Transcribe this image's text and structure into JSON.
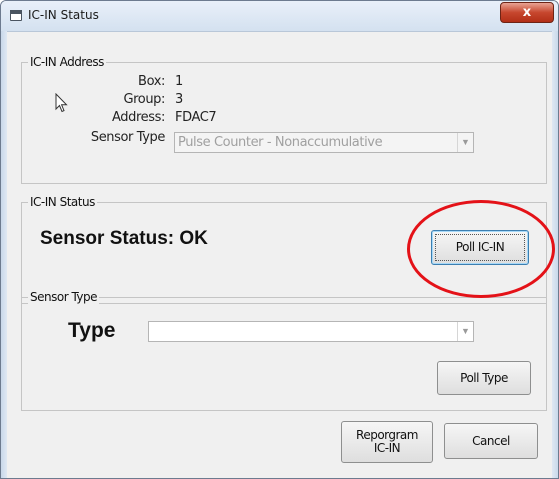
{
  "window": {
    "title": "IC-IN Status",
    "close_glyph": "x"
  },
  "address_group": {
    "legend": "IC-IN Address",
    "box_label": "Box:",
    "box_value": "1",
    "group_label": "Group:",
    "group_value": "3",
    "address_label": "Address:",
    "address_value": "FDAC7",
    "sensor_type_label": "Sensor Type",
    "sensor_type_value": "Pulse Counter - Nonaccumulative"
  },
  "status_group": {
    "legend": "IC-IN Status",
    "status_text": "Sensor Status: OK",
    "poll_button": "Poll IC-IN"
  },
  "sensor_type_group": {
    "legend": "Sensor Type",
    "type_label": "Type",
    "type_value": "",
    "poll_type_button": "Poll Type"
  },
  "footer": {
    "reprogram_button_line1": "Reporgram",
    "reprogram_button_line2": "IC-IN",
    "cancel_button": "Cancel"
  },
  "colors": {
    "annotation_circle": "#e41218",
    "close_button": "#c7472e"
  },
  "icons": {
    "title_icon": "window-icon",
    "cursor": "mouse-pointer-icon",
    "dropdown": "chevron-down-icon"
  }
}
